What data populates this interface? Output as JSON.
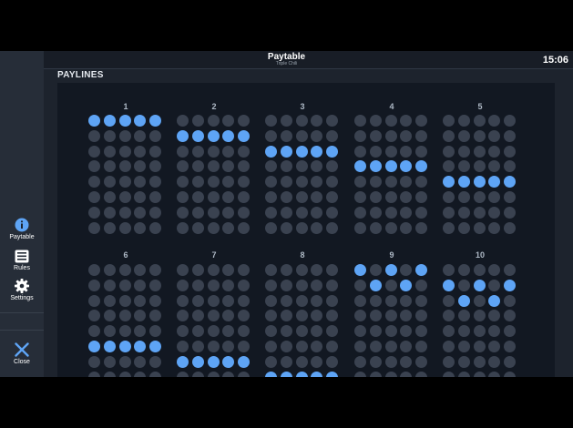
{
  "header": {
    "title": "Paytable",
    "subtitle": "Triple Chili",
    "clock": "15:06"
  },
  "sidebar": {
    "items": [
      {
        "id": "paytable",
        "label": "Paytable",
        "icon": "info-icon",
        "active": true
      },
      {
        "id": "rules",
        "label": "Rules",
        "icon": "rules-icon"
      },
      {
        "id": "settings",
        "label": "Settings",
        "icon": "gear-icon"
      },
      {
        "id": "close",
        "label": "Close",
        "icon": "close-icon"
      }
    ]
  },
  "section": {
    "title": "PAYLINES"
  },
  "colors": {
    "active_dot": "#5ea4f5",
    "inactive_dot": "#3a4250",
    "accent": "#5ea4f5"
  },
  "paylines": [
    {
      "label": "1",
      "rows": [
        0,
        0,
        0,
        0,
        0
      ]
    },
    {
      "label": "2",
      "rows": [
        1,
        1,
        1,
        1,
        1
      ]
    },
    {
      "label": "3",
      "rows": [
        2,
        2,
        2,
        2,
        2
      ]
    },
    {
      "label": "4",
      "rows": [
        3,
        3,
        3,
        3,
        3
      ]
    },
    {
      "label": "5",
      "rows": [
        4,
        4,
        4,
        4,
        4
      ]
    },
    {
      "label": "6",
      "rows": [
        5,
        5,
        5,
        5,
        5
      ]
    },
    {
      "label": "7",
      "rows": [
        6,
        6,
        6,
        6,
        6
      ]
    },
    {
      "label": "8",
      "rows": [
        7,
        7,
        7,
        7,
        7
      ]
    },
    {
      "label": "9",
      "rows": [
        0,
        1,
        0,
        1,
        0
      ]
    },
    {
      "label": "10",
      "rows": [
        1,
        2,
        1,
        2,
        1
      ]
    }
  ]
}
